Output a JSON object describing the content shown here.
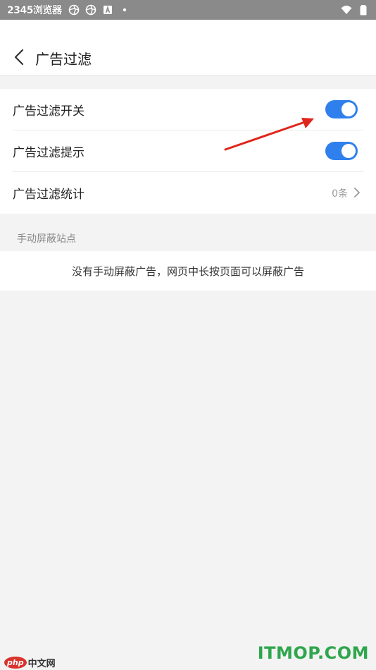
{
  "status_bar": {
    "app_name": "2345浏览器",
    "left_icons": [
      "aperture-icon",
      "aperture-icon",
      "a-badge-icon",
      "dot-icon"
    ],
    "right_icons": [
      "wifi-icon",
      "battery-icon"
    ]
  },
  "header": {
    "title": "广告过滤",
    "back_icon": "chevron-left-icon"
  },
  "settings": {
    "items": [
      {
        "label": "广告过滤开关",
        "toggle_on": true
      },
      {
        "label": "广告过滤提示",
        "toggle_on": true
      },
      {
        "label": "广告过滤统计",
        "value": "0条"
      }
    ]
  },
  "manual_block": {
    "section_title": "手动屏蔽站点",
    "empty_text": "没有手动屏蔽广告，网页中长按页面可以屏蔽广告"
  },
  "watermarks": {
    "left_brand": "php",
    "left_suffix": "中文网",
    "right_brand": "ITMOP.COM"
  },
  "colors": {
    "toggle_on": "#2f80ed",
    "annotation_arrow": "#e0261b",
    "watermark_green": "#2fa64d"
  }
}
